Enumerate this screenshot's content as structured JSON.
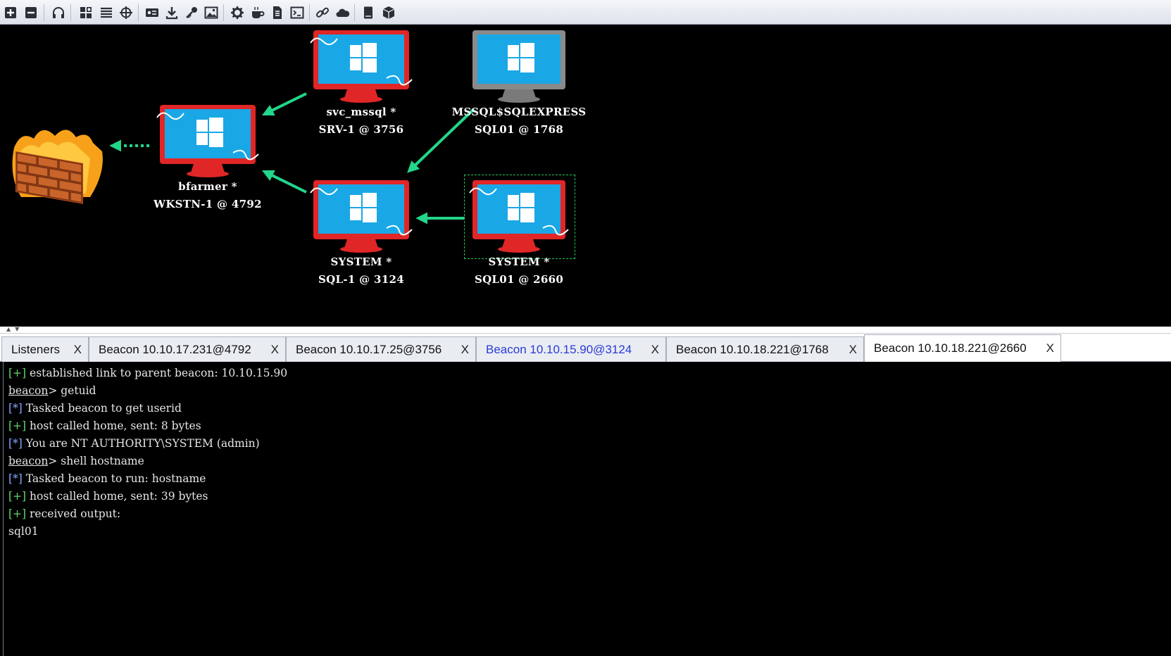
{
  "toolbar": {
    "icons": [
      "plus-icon",
      "minus-icon",
      "headphones-icon",
      "graph-view-icon",
      "list-view-icon",
      "target-icon",
      "card-icon",
      "download-icon",
      "key-icon",
      "image-icon",
      "gear-icon",
      "coffee-icon",
      "document-icon",
      "terminal-icon",
      "link-icon",
      "cloud-icon",
      "book-icon",
      "cube-icon"
    ]
  },
  "graph": {
    "nodes": [
      {
        "id": "wkstn1",
        "user": "bfarmer *",
        "host": "WKSTN-1 @ 4792",
        "status": "active"
      },
      {
        "id": "srv1",
        "user": "svc_mssql *",
        "host": "SRV-1 @ 3756",
        "status": "active"
      },
      {
        "id": "sql01a",
        "user": "MSSQL$SQLEXPRESS",
        "host": "SQL01 @ 1768",
        "status": "inactive"
      },
      {
        "id": "sql1",
        "user": "SYSTEM *",
        "host": "SQL-1 @ 3124",
        "status": "active"
      },
      {
        "id": "sql01b",
        "user": "SYSTEM *",
        "host": "SQL01 @ 2660",
        "status": "active",
        "selected": true
      }
    ],
    "colors": {
      "active": "#e02626",
      "inactive": "#8a8a8a",
      "link": "#22d68a",
      "screen": "#1aa7e6"
    }
  },
  "tabs": [
    {
      "label": "Listeners",
      "close": "X"
    },
    {
      "label": "Beacon 10.10.17.231@4792",
      "close": "X"
    },
    {
      "label": "Beacon 10.10.17.25@3756",
      "close": "X"
    },
    {
      "label": "Beacon 10.10.15.90@3124",
      "close": "X",
      "highlight": true
    },
    {
      "label": "Beacon 10.10.18.221@1768",
      "close": "X"
    },
    {
      "label": "Beacon 10.10.18.221@2660",
      "close": "X",
      "active": true
    }
  ],
  "console": {
    "lines": [
      {
        "tag": "[+]",
        "text": " established link to parent beacon: 10.10.15.90"
      },
      {
        "prompt": "beacon",
        "text": "> getuid"
      },
      {
        "tag": "[*]",
        "text": " Tasked beacon to get userid"
      },
      {
        "tag": "[+]",
        "text": " host called home, sent: 8 bytes"
      },
      {
        "tag": "[*]",
        "text": " You are NT AUTHORITY\\SYSTEM (admin)"
      },
      {
        "prompt": "beacon",
        "text": "> shell hostname"
      },
      {
        "tag": "[*]",
        "text": " Tasked beacon to run: hostname"
      },
      {
        "tag": "[+]",
        "text": " host called home, sent: 39 bytes"
      },
      {
        "tag": "[+]",
        "text": " received output:"
      },
      {
        "text": "sql01"
      }
    ]
  }
}
